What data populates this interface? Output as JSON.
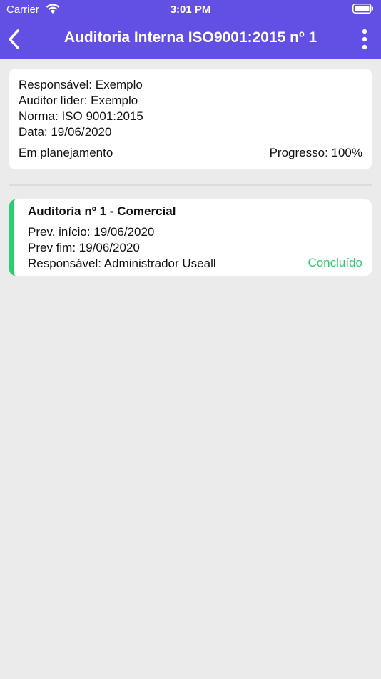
{
  "status_bar": {
    "carrier": "Carrier",
    "time": "3:01 PM",
    "wifi_icon": "wifi-icon",
    "battery_icon": "battery-icon"
  },
  "nav": {
    "title": "Auditoria Interna ISO9001:2015 nº 1",
    "back_icon": "chevron-left-icon",
    "menu_icon": "more-vertical-icon",
    "background": "#6150e3"
  },
  "summary": {
    "responsavel": "Responsável: Exemplo",
    "auditor_lider": "Auditor líder: Exemplo",
    "norma": "Norma: ISO 9001:2015",
    "data": "Data: 19/06/2020",
    "status": "Em planejamento",
    "progress": "Progresso: 100%",
    "progress_value": 100
  },
  "audits": [
    {
      "title": "Auditoria nº 1 - Comercial",
      "prev_inicio": "Prev. início: 19/06/2020",
      "prev_fim": "Prev fim: 19/06/2020",
      "responsavel": "Responsável: Administrador Useall",
      "status": "Concluído",
      "status_color": "#2ecc71"
    }
  ]
}
